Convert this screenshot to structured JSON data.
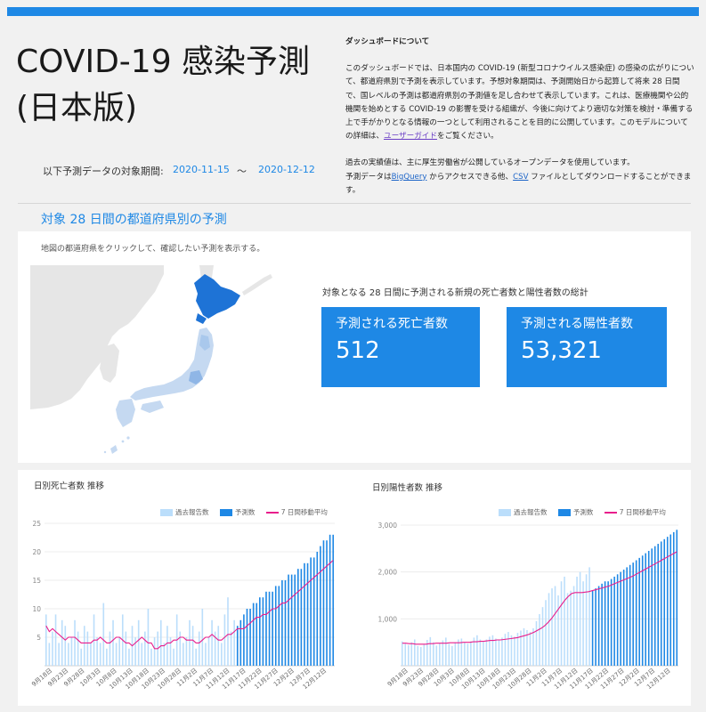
{
  "header": {
    "title_line1": "COVID-19 感染予測",
    "title_line2": "(日本版)",
    "period_label": "以下予測データの対象期間:",
    "period_start": "2020-11-15",
    "period_sep": "〜",
    "period_end": "2020-12-12"
  },
  "about": {
    "heading": "ダッシュボードについて",
    "p1_a": "このダッシュボードでは、日本国内の COVID-19 (新型コロナウイルス感染症) の感染の広がりについて、都道府県別で予測を表示しています。予想対象期間は、予測開始日から起算して将来 28 日間で、国レベルの予測は都道府県別の予測値を足し合わせて表示しています。これは、医療機関や公的機関を始めとする COVID-19 の影響を受ける組織が、今後に向けてより適切な対策を検討・準備する上で手がかりとなる情報の一つとして利用されることを目的に公開しています。このモデルについての詳細は、",
    "p1_link": "ユーザーガイド",
    "p1_b": "をご覧ください。",
    "p2_a": "過去の実績値は、主に厚生労働省が公開しているオープンデータを使用しています。",
    "p2_b": "予測データは",
    "p2_link1": "BigQuery",
    "p2_c": " からアクセスできる他、",
    "p2_link2": "CSV",
    "p2_d": " ファイルとしてダウンロードすることができます。"
  },
  "section": {
    "title": "対象 28 日間の都道府県別の予測"
  },
  "map": {
    "hint": "地図の都道府県をクリックして、確認したい予測を表示する。"
  },
  "totals": {
    "label": "対象となる 28 日間に予測される新規の死亡者数と陽性者数の総計",
    "deaths_label": "予測される死亡者数",
    "deaths_value": "512",
    "cases_label": "予測される陽性者数",
    "cases_value": "53,321"
  },
  "colors": {
    "accent": "#1e88e5",
    "past_bar": "#bbdefb",
    "forecast_bar": "#1e88e5",
    "moving_avg": "#e91e8c",
    "map_land": "#e6e6e6",
    "map_japan": "#c5d9f1",
    "map_hokkaido": "#1e73d6"
  },
  "chart_data": [
    {
      "type": "bar",
      "title": "日別死亡者数 推移",
      "legend": [
        "過去報告数",
        "予測数",
        "7 日間移動平均"
      ],
      "ylim": [
        0,
        25
      ],
      "yticks": [
        5,
        10,
        15,
        20,
        25
      ],
      "x_tick_labels": [
        "9月18日",
        "9月23日",
        "9月28日",
        "10月3日",
        "10月8日",
        "10月13日",
        "10月18日",
        "10月23日",
        "10月28日",
        "11月2日",
        "11月7日",
        "11月12日",
        "11月17日",
        "11月22日",
        "11月27日",
        "12月2日",
        "12月7日",
        "12月12日"
      ],
      "past_values": [
        9,
        4,
        6,
        9,
        4,
        8,
        7,
        4,
        5,
        8,
        6,
        3,
        7,
        6,
        4,
        9,
        5,
        4,
        11,
        3,
        6,
        8,
        4,
        5,
        9,
        6,
        3,
        7,
        5,
        8,
        4,
        6,
        10,
        3,
        5,
        6,
        8,
        4,
        7,
        5,
        3,
        9,
        6,
        4,
        5,
        8,
        7,
        3,
        6,
        10,
        4,
        5,
        8,
        6,
        7,
        4,
        9,
        12,
        6,
        8
      ],
      "forecast_values": [
        7,
        8,
        9,
        10,
        10,
        11,
        11,
        12,
        12,
        13,
        13,
        13,
        14,
        14,
        15,
        15,
        16,
        16,
        16,
        17,
        17,
        18,
        18,
        19,
        19,
        20,
        21,
        22,
        22,
        23,
        23
      ],
      "moving_avg": [
        7,
        6,
        6.5,
        6,
        5.5,
        5,
        4.5,
        5,
        5,
        5,
        4.5,
        4,
        4,
        4,
        4,
        4.5,
        4.5,
        5,
        4.5,
        4,
        4,
        4.5,
        5,
        5,
        4.5,
        4,
        4,
        3.5,
        4,
        4.5,
        5,
        4.5,
        4,
        4,
        3,
        3,
        3.5,
        3.5,
        4,
        4,
        4.5,
        4.5,
        5,
        5,
        4.5,
        4.5,
        4.5,
        4,
        4,
        4.5,
        5,
        5,
        5.5,
        5,
        4.5,
        4.5,
        5,
        5.5,
        5.5,
        6,
        6.5,
        6.5,
        6.5,
        7,
        7.5,
        8,
        8.5,
        8.5,
        9,
        9,
        9.5,
        10,
        10,
        10.5,
        11,
        11,
        11.5,
        12,
        12.5,
        13,
        13.5,
        14,
        14.5,
        15,
        15.5,
        16,
        16.5,
        17,
        17.5,
        18,
        18.5
      ]
    },
    {
      "type": "bar",
      "title": "日別陽性者数 推移",
      "legend": [
        "過去報告数",
        "予測数",
        "7 日間移動平均"
      ],
      "ylim": [
        0,
        3000
      ],
      "yticks": [
        1000,
        2000,
        3000
      ],
      "ytick_labels": [
        "1,000",
        "2,000",
        "3,000"
      ],
      "x_tick_labels": [
        "9月18日",
        "9月23日",
        "9月28日",
        "10月3日",
        "10月8日",
        "10月13日",
        "10月18日",
        "10月23日",
        "10月28日",
        "11月2日",
        "11月7日",
        "11月12日",
        "11月17日",
        "11月22日",
        "11月27日",
        "12月2日",
        "12月7日",
        "12月12日"
      ],
      "past_values": [
        520,
        470,
        440,
        500,
        560,
        420,
        400,
        460,
        550,
        610,
        500,
        430,
        480,
        540,
        600,
        470,
        420,
        500,
        560,
        580,
        500,
        470,
        520,
        600,
        650,
        560,
        510,
        560,
        620,
        650,
        580,
        560,
        600,
        680,
        720,
        650,
        620,
        700,
        750,
        800,
        760,
        720,
        800,
        950,
        1100,
        1250,
        1400,
        1550,
        1650,
        1700,
        1500,
        1800,
        1900,
        1550,
        1600,
        1700,
        1900,
        2000,
        1800,
        1950,
        2100
      ],
      "forecast_values": [
        1600,
        1650,
        1700,
        1750,
        1800,
        1800,
        1850,
        1900,
        1950,
        2000,
        2050,
        2100,
        2150,
        2200,
        2250,
        2300,
        2350,
        2400,
        2450,
        2500,
        2550,
        2600,
        2650,
        2700,
        2750,
        2800,
        2850,
        2900
      ],
      "moving_avg": [
        480,
        480,
        470,
        470,
        460,
        460,
        460,
        460,
        470,
        470,
        480,
        480,
        480,
        480,
        490,
        490,
        490,
        490,
        500,
        500,
        500,
        510,
        510,
        520,
        520,
        530,
        540,
        540,
        550,
        550,
        560,
        570,
        580,
        590,
        600,
        620,
        640,
        660,
        690,
        720,
        760,
        800,
        850,
        920,
        1000,
        1100,
        1200,
        1300,
        1400,
        1480,
        1540,
        1560,
        1560,
        1560,
        1570,
        1580,
        1600,
        1620,
        1640,
        1660,
        1680,
        1700,
        1730,
        1760,
        1790,
        1820,
        1850,
        1880,
        1910,
        1950,
        1990,
        2030,
        2070,
        2110,
        2150,
        2190,
        2230,
        2270,
        2310,
        2350,
        2390,
        2430
      ]
    }
  ]
}
